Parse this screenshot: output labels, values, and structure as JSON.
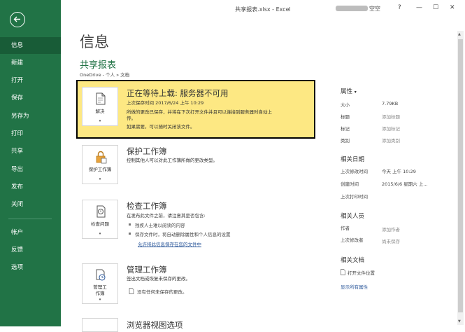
{
  "titlebar": {
    "title": "共享报表.xlsx - Excel",
    "account_suffix": "空空",
    "help": "?",
    "minimize": "—",
    "restore": "☐",
    "close": "✕"
  },
  "sidebar": {
    "items": [
      "信息",
      "新建",
      "打开",
      "保存",
      "另存为",
      "打印",
      "共享",
      "导出",
      "发布",
      "关闭",
      "帐户",
      "反馈",
      "选项"
    ],
    "active": "信息"
  },
  "main": {
    "title": "信息",
    "subtitle": "共享报表",
    "path": "OneDrive - 个人 » 文档"
  },
  "sections": {
    "upload": {
      "tile_label": "解决",
      "heading": "正在等待上载: 服务器不可用",
      "line1": "上次保存时间 2017/6/24 上午 10:29",
      "line2": "所做的更改已保存，并将在下次打开文件并且可以连接到服务器时自动上",
      "line3": "传。",
      "line4": "如果需要，可以随时关闭该文件。"
    },
    "protect": {
      "tile_label": "保护工作簿",
      "heading": "保护工作簿",
      "desc": "控制其他人可以对此工作簿所做的更改类型。"
    },
    "inspect": {
      "tile_label": "检查问题",
      "heading": "检查工作簿",
      "desc": "在发布此文件之前，请注意其是否包含:",
      "bullet1": "残疾人士难以阅读的内容",
      "bullet2": "保存文件时，将自动删除属性和个人信息的设置",
      "link": "允许将此信息保存在您的文件中"
    },
    "manage": {
      "tile_label1": "管理工",
      "tile_label2": "作簿",
      "heading": "管理工作簿",
      "desc": "签出文档或恢复未保存的更改。",
      "note": "没有任何未保存的更改。"
    },
    "browser": {
      "heading": "浏览器视图选项"
    }
  },
  "properties": {
    "heading": "属性",
    "size_k": "大小",
    "size_v": "7.79KB",
    "title_k": "标题",
    "title_v": "添加标题",
    "tags_k": "标记",
    "tags_v": "添加标记",
    "category_k": "类别",
    "category_v": "添加类别",
    "dates_heading": "相关日期",
    "modified_k": "上次修改时间",
    "modified_v": "今天 上午 10:29",
    "created_k": "创建时间",
    "created_v": "2015/6/6 星期六 上...",
    "printed_k": "上次打印时间",
    "people_heading": "相关人员",
    "author_k": "作者",
    "author_v": "添加作者",
    "lastmod_k": "上次修改者",
    "lastmod_v": "尚未保存",
    "docs_heading": "相关文档",
    "open_location": "打开文件位置",
    "show_all": "显示所有属性"
  },
  "colors": {
    "accent": "#217346",
    "active_nav": "#185c37",
    "banner": "#fde883",
    "link": "#2b579a"
  }
}
